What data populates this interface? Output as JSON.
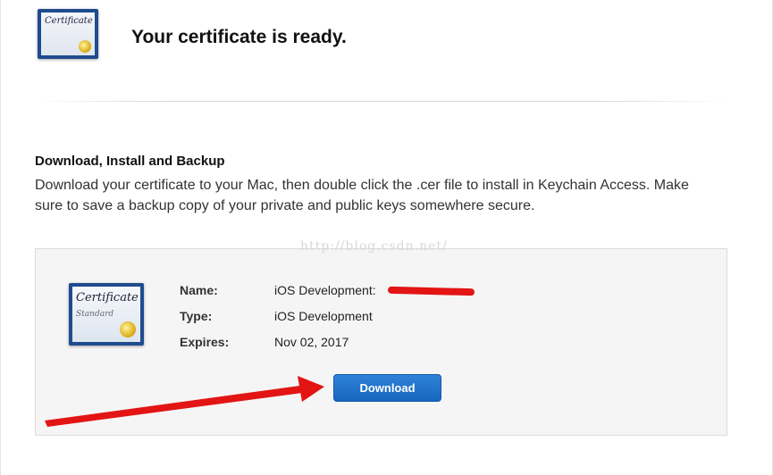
{
  "header": {
    "icon": "certificate-icon",
    "icon_text": "Certificate",
    "title": "Your certificate is ready."
  },
  "section": {
    "heading": "Download, Install and Backup",
    "description": "Download your certificate to your Mac, then double click the .cer file to install in Keychain Access. Make sure to save a backup copy of your private and public keys somewhere secure."
  },
  "watermark": "http://blog.csdn.net/",
  "certificate": {
    "icon": "certificate-standard-icon",
    "icon_title": "Certificate",
    "icon_subtitle": "Standard",
    "fields": {
      "name_label": "Name:",
      "name_value": "iOS Development:",
      "type_label": "Type:",
      "type_value": "iOS Development",
      "expires_label": "Expires:",
      "expires_value": "Nov 02, 2017"
    },
    "download_label": "Download"
  },
  "annotations": {
    "arrow_color": "#e31414",
    "redaction_color": "#e31414"
  },
  "colors": {
    "button_blue": "#1f73cc",
    "icon_blue": "#1f4c8f",
    "card_bg": "#f5f5f5"
  }
}
